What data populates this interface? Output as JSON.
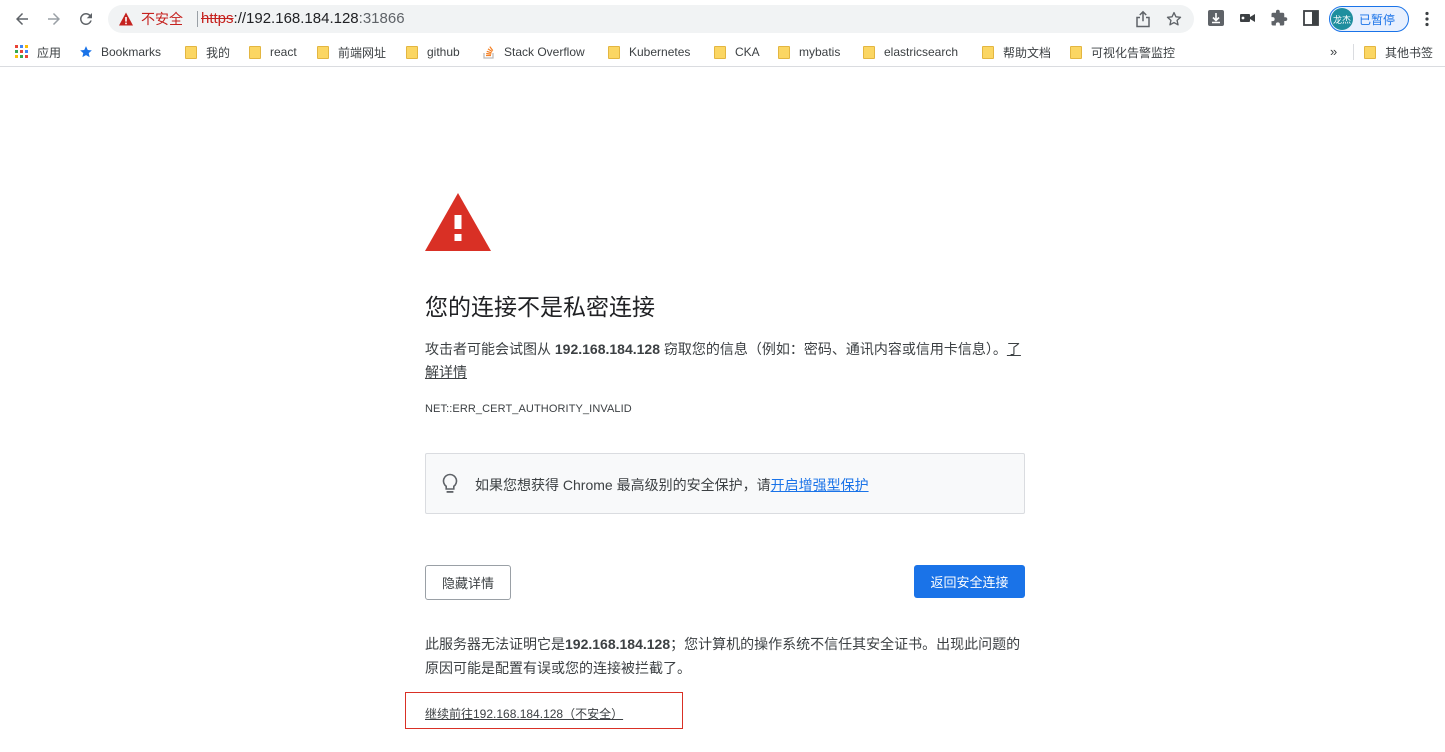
{
  "toolbar": {
    "security_status": "不安全",
    "url": {
      "scheme": "https",
      "rest": "://192.168.184.128",
      "port": ":31866"
    },
    "profile": {
      "avatar_text": "龙杰",
      "label": "已暂停"
    }
  },
  "bookmarks": {
    "items": [
      {
        "label": "应用",
        "icon": "apps-grid-icon"
      },
      {
        "label": "Bookmarks",
        "icon": "star-icon"
      },
      {
        "label": "我的",
        "icon": "folder-icon"
      },
      {
        "label": "react",
        "icon": "folder-icon"
      },
      {
        "label": "前端网址",
        "icon": "folder-icon"
      },
      {
        "label": "github",
        "icon": "folder-icon"
      },
      {
        "label": "Stack Overflow",
        "icon": "stackoverflow-icon"
      },
      {
        "label": "Kubernetes",
        "icon": "folder-icon"
      },
      {
        "label": "CKA",
        "icon": "folder-icon"
      },
      {
        "label": "mybatis",
        "icon": "folder-icon"
      },
      {
        "label": "elastricsearch",
        "icon": "folder-icon"
      },
      {
        "label": "帮助文档",
        "icon": "folder-icon"
      },
      {
        "label": "可视化告警监控",
        "icon": "folder-icon"
      }
    ],
    "more_label": "»",
    "other_bookmarks": "其他书签"
  },
  "interstitial": {
    "heading": "您的连接不是私密连接",
    "desc_prefix": "攻击者可能会试图从 ",
    "host": "192.168.184.128",
    "desc_suffix": " 窃取您的信息（例如：密码、通讯内容或信用卡信息）。",
    "learn_more": "了解详情",
    "error_code": "NET::ERR_CERT_AUTHORITY_INVALID",
    "enhanced_prefix": "如果您想获得 Chrome 最高级别的安全保护，请",
    "enhanced_link": "开启增强型保护",
    "details_button": "隐藏详情",
    "back_button": "返回安全连接",
    "details_prefix": "此服务器无法证明它是",
    "details_host": "192.168.184.128",
    "details_suffix": "；您计算机的操作系统不信任其安全证书。出现此问题的原因可能是配置有误或您的连接被拦截了。",
    "proceed_link": "继续前往192.168.184.128（不安全）"
  },
  "colors": {
    "accent": "#1a73e8",
    "danger": "#d93025",
    "highlight_box": "#d93025"
  }
}
